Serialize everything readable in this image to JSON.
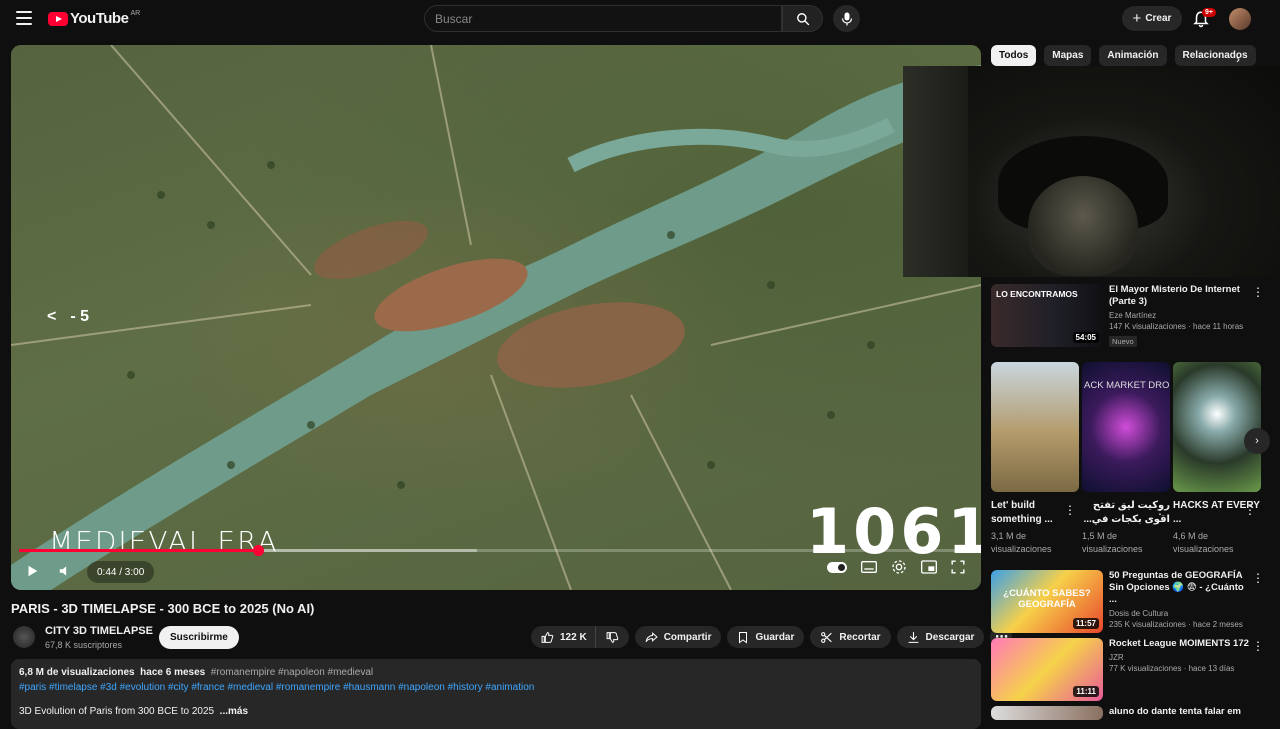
{
  "header": {
    "logo_text": "YouTube",
    "country_code": "AR",
    "search_placeholder": "Buscar",
    "create_label": "Crear",
    "notification_count": "9+"
  },
  "player": {
    "skip_label": "- 5",
    "era_text": "MEDIEVAL ERA",
    "year_text": "1061",
    "time_display": "0:44 / 3:00",
    "played_fraction": 0.25,
    "buffered_fraction": 0.48
  },
  "video": {
    "title": "PARIS - 3D TIMELAPSE - 300 BCE to 2025 (No AI)",
    "channel_name": "CITY 3D TIMELAPSE",
    "subscribers": "67,8 K suscriptores",
    "subscribe_label": "Suscribirme",
    "likes": "122 K",
    "share_label": "Compartir",
    "save_label": "Guardar",
    "clip_label": "Recortar",
    "download_label": "Descargar"
  },
  "description": {
    "views": "6,8 M de visualizaciones",
    "age": "hace 6 meses",
    "inline_tags": "#romanempire #napoleon #medieval",
    "hashtags": "#paris #timelapse #3d #evolution #city #france #medieval #romanempire #hausmann #napoleon #history #animation",
    "snippet": "3D Evolution of Paris from 300 BCE to 2025",
    "more_label": "...más"
  },
  "chips": [
    "Todos",
    "Mapas",
    "Animación",
    "Relacionados"
  ],
  "recommendations": [
    {
      "title": "El Mayor Misterio De Internet (Parte 3)",
      "channel": "Eze Martínez",
      "meta": "147 K visualizaciones · hace 11 horas",
      "duration": "54:05",
      "thumb_text": "LO ENCONTRAMOS",
      "badge": "Nuevo"
    },
    {
      "title": "50 Preguntas de GEOGRAFÍA Sin Opciones 🌍 😨 - ¿Cuánto ...",
      "channel": "Dosis de Cultura",
      "meta": "235 K visualizaciones · hace 2 meses",
      "duration": "11:57",
      "thumb_text": "¿CUÁNTO SABES? GEOGRAFÍA"
    },
    {
      "title": "Rocket League MOIMENTS 172",
      "channel": "JZR",
      "meta": "77 K visualizaciones · hace 13 días",
      "duration": "11:11"
    },
    {
      "title": "aluno do dante tenta falar em"
    }
  ],
  "shorts": [
    {
      "title": "Let' build something ...",
      "views": "3,1 M de visualizaciones"
    },
    {
      "title": "روكيت ليق تفتح اقوى بكجات في...",
      "views": "1,5 M de visualizaciones",
      "thumb_text": "ACK MARKET DRO"
    },
    {
      "title": "HACKS AT EVERY ...",
      "views": "4,6 M de visualizaciones"
    }
  ]
}
